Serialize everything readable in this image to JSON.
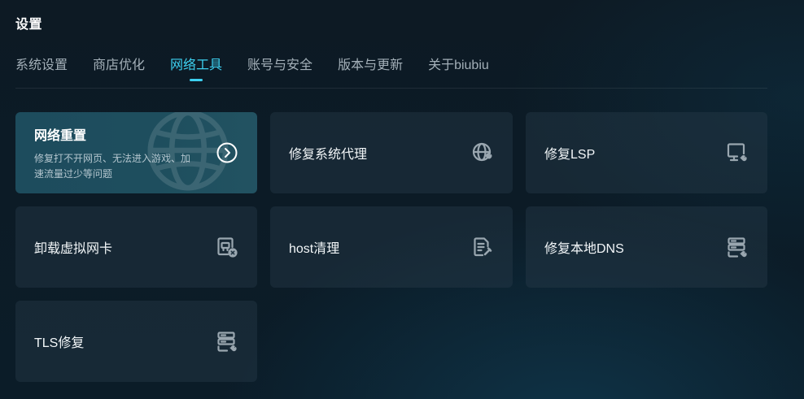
{
  "header": {
    "title": "设置"
  },
  "tabs": [
    {
      "label": "系统设置",
      "active": false
    },
    {
      "label": "商店优化",
      "active": false
    },
    {
      "label": "网络工具",
      "active": true
    },
    {
      "label": "账号与安全",
      "active": false
    },
    {
      "label": "版本与更新",
      "active": false
    },
    {
      "label": "关于biubiu",
      "active": false
    }
  ],
  "cards": {
    "network_reset": {
      "title": "网络重置",
      "description": "修复打不开网页、无法进入游戏、加速流量过少等问题",
      "icon": "arrow-right-circle-icon"
    },
    "fix_proxy": {
      "label": "修复系统代理",
      "icon": "globe-wrench-icon"
    },
    "fix_lsp": {
      "label": "修复LSP",
      "icon": "monitor-wrench-icon"
    },
    "uninstall_nic": {
      "label": "卸载虚拟网卡",
      "icon": "nic-remove-icon"
    },
    "host_clean": {
      "label": "host清理",
      "icon": "document-edit-icon"
    },
    "fix_dns": {
      "label": "修复本地DNS",
      "icon": "server-wrench-icon"
    },
    "tls_fix": {
      "label": "TLS修复",
      "icon": "server-wrench-icon"
    }
  },
  "colors": {
    "accent": "#3dd0f0",
    "icon": "#9aa7b0",
    "tab_inactive": "#a3afb8"
  }
}
